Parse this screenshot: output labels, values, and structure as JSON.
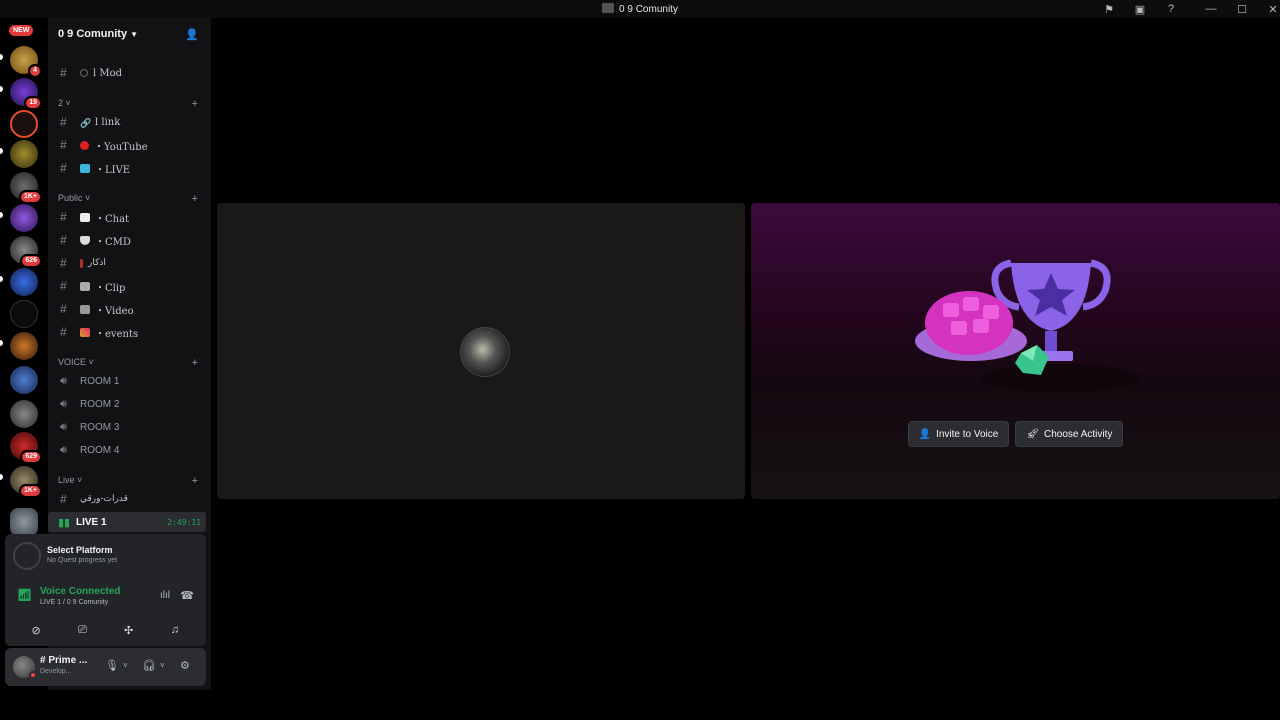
{
  "window": {
    "title": "0 9 Comunity"
  },
  "server_rail": {
    "new_badge": "NEW",
    "badges": [
      "4",
      "19",
      "1K+",
      "626",
      "629",
      "1K+"
    ]
  },
  "server": {
    "name": "0 9 Comunity"
  },
  "channels_top": [
    {
      "name": "l Mod",
      "type": "text"
    }
  ],
  "categories": [
    {
      "label": "2",
      "channels": [
        {
          "name": "l link",
          "emoji": "link-icon"
        },
        {
          "name": "・YouTube",
          "emoji": "red-dot-icon"
        },
        {
          "name": "・LIVE",
          "emoji": "live-icon"
        }
      ]
    },
    {
      "label": "Public",
      "channels": [
        {
          "name": "・Chat",
          "emoji": "chat-icon"
        },
        {
          "name": "・CMD",
          "emoji": "shield-icon"
        },
        {
          "name": "اذكار",
          "emoji": "pin-icon"
        },
        {
          "name": "・Clip",
          "emoji": "clapper-icon"
        },
        {
          "name": "・Video",
          "emoji": "video-icon"
        },
        {
          "name": "・events",
          "emoji": "party-icon"
        }
      ]
    },
    {
      "label": "VOICE",
      "channels": [
        {
          "name": "ROOM 1"
        },
        {
          "name": "ROOM 2"
        },
        {
          "name": "ROOM 3"
        },
        {
          "name": "ROOM 4"
        }
      ]
    },
    {
      "label": "Live",
      "channels": [
        {
          "name": "قدرات-ورقي"
        }
      ]
    }
  ],
  "active_voice": {
    "name": "LIVE 1",
    "elapsed": "2:49:11"
  },
  "quest": {
    "title": "Select Platform",
    "subtitle": "No Quest progress yet"
  },
  "voice_status": {
    "title": "Voice Connected",
    "subtitle": "LIVE 1 / 0 9 Comunity"
  },
  "user": {
    "name": "# Prime ...",
    "status": "Develop..."
  },
  "stage": {
    "invite_label": "Invite to Voice",
    "activity_label": "Choose Activity"
  },
  "colors": {
    "accent_green": "#23a55a",
    "badge_red": "#e23b3b",
    "purple": "#7b2d8e"
  }
}
